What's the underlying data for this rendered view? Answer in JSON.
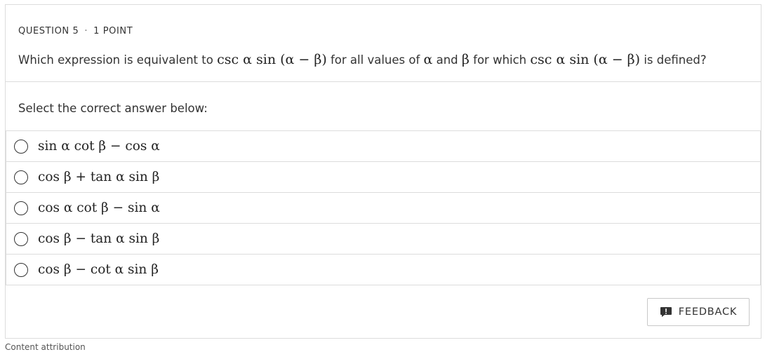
{
  "question": {
    "number_label": "QUESTION 5",
    "separator": "·",
    "points_label": "1 POINT",
    "text_before": "Which expression is equivalent to ",
    "expr1": "csc α sin (α − β)",
    "text_middle1": " for all values of ",
    "alpha": "α",
    "text_and": " and ",
    "beta": "β",
    "text_middle2": " for which ",
    "expr2": "csc α sin (α − β)",
    "text_after": " is defined?"
  },
  "instruction": "Select the correct answer below:",
  "options": [
    {
      "label": "sin α cot β − cos α"
    },
    {
      "label": "cos β + tan α sin β"
    },
    {
      "label": "cos α cot β − sin α"
    },
    {
      "label": "cos β − tan α sin β"
    },
    {
      "label": "cos β − cot α sin β"
    }
  ],
  "feedback": {
    "label": "FEEDBACK",
    "icon": "feedback-icon"
  },
  "footer": {
    "text": "Content attribution"
  }
}
